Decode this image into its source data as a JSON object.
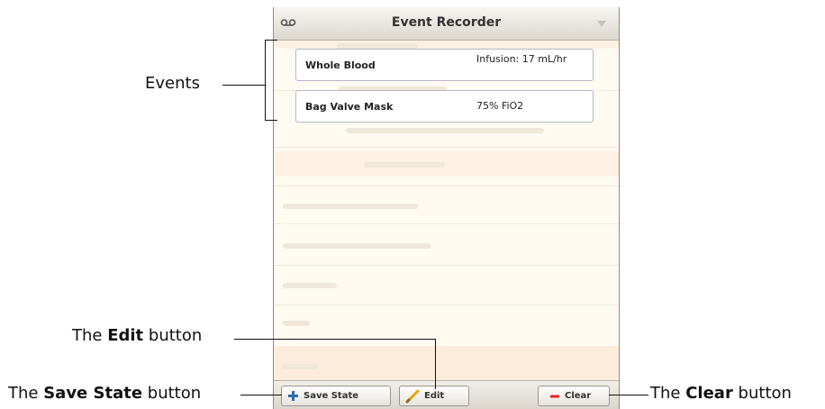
{
  "panel": {
    "title": "Event Recorder",
    "header_icon": "voicemail-icon",
    "menu_icon": "dropdown-arrow-icon"
  },
  "events": [
    {
      "name": "Whole Blood",
      "detail": "Infusion: 17 mL/hr"
    },
    {
      "name": "Bag Valve Mask",
      "detail": "75% FiO2"
    }
  ],
  "footer": {
    "save_state_label": "Save State",
    "save_state_icon": "plus-icon",
    "edit_label": "Edit",
    "edit_icon": "pencil-icon",
    "clear_label": "Clear",
    "clear_icon": "minus-icon"
  },
  "annotations": {
    "events": "Events",
    "edit_prefix": "The ",
    "edit_bold": "Edit",
    "edit_suffix": " button",
    "save_prefix": "The ",
    "save_bold": "Save State",
    "save_suffix": " button",
    "clear_prefix": "The ",
    "clear_bold": "Clear",
    "clear_suffix": " button"
  },
  "colors": {
    "panel_background": "#fffaf2",
    "clear_icon": "#e8252b",
    "save_icon": "#2b6cb0",
    "edit_icon": "#e9a400"
  }
}
